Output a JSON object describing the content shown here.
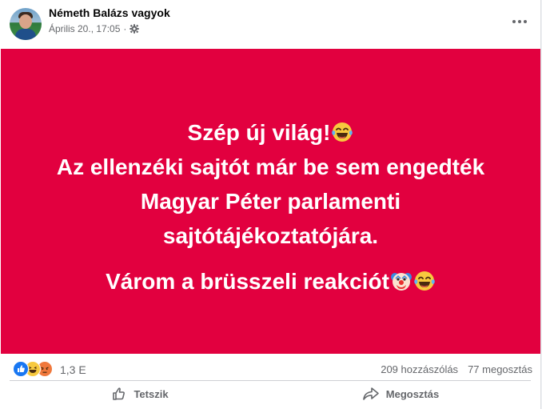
{
  "post": {
    "author": "Németh Balázs vagyok",
    "date": "Április 20., 17:05",
    "separator": "·",
    "privacy_icon": "gear-icon",
    "more_icon": "more-options-icon"
  },
  "image": {
    "background_color": "#e2003f",
    "text_color": "#ffffff",
    "lines": {
      "l1": "Szép új világ!",
      "l2": "Az ellenzéki sajtót már be sem engedték",
      "l3": "Magyar Péter parlamenti",
      "l4": "sajtótájékoztatójára.",
      "l5": "Várom a brüsszeli reakciót"
    },
    "emojis": [
      "laughing-tears-emoji",
      "clown-emoji",
      "laughing-tears-emoji"
    ]
  },
  "stats": {
    "reaction_icons": [
      "like-reaction-icon",
      "haha-reaction-icon",
      "angry-reaction-icon"
    ],
    "reaction_count": "1,3 E",
    "comments": "209 hozzászólás",
    "shares": "77 megosztás"
  },
  "actions": {
    "like_label": "Tetszik",
    "share_label": "Megosztás"
  },
  "colors": {
    "accent": "#1877f2",
    "muted_text": "#65676b"
  }
}
